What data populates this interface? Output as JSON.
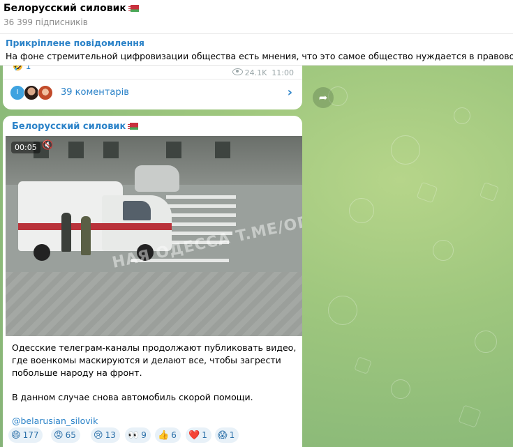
{
  "channel": {
    "name": "Белорусский силовик",
    "subscribers": "36 399 підписників"
  },
  "pinned": {
    "title": "Прикріплене повідомлення",
    "text": "На фоне стремительной цифровизации общества есть мнения, что это самое общество нуждается в правовом прос"
  },
  "message1": {
    "reaction_count": "1",
    "views": "24.1K",
    "time": "11:00",
    "comments_label": "39 коментарів",
    "avatar_letter": "I"
  },
  "message2": {
    "sender": "Белорусский силовик",
    "video_time": "00:05",
    "video_watermark": "НАЯ ОДЕССА T.ME/OD",
    "text_para1": "Одесские телеграм-каналы продолжают публиковать видео, где военкомы маскируются и делают все, чтобы загрести побольше народу на фронт.",
    "text_para2": "В данном случае снова автомобиль скорой помощи.",
    "link": "@belarusian_silovik",
    "reactions": [
      {
        "emoji": "😄",
        "count": "177"
      },
      {
        "emoji": "😡",
        "count": "65"
      },
      {
        "emoji": "😢",
        "count": "13"
      },
      {
        "emoji": "👀",
        "count": "9"
      },
      {
        "emoji": "👍",
        "count": "6"
      },
      {
        "emoji": "❤️",
        "count": "1"
      },
      {
        "emoji": "😱",
        "count": "1"
      }
    ]
  },
  "colors": {
    "accent": "#2a82c8",
    "chat_bg": "#9fc77e",
    "reaction_bg": "#e8f1f8"
  }
}
